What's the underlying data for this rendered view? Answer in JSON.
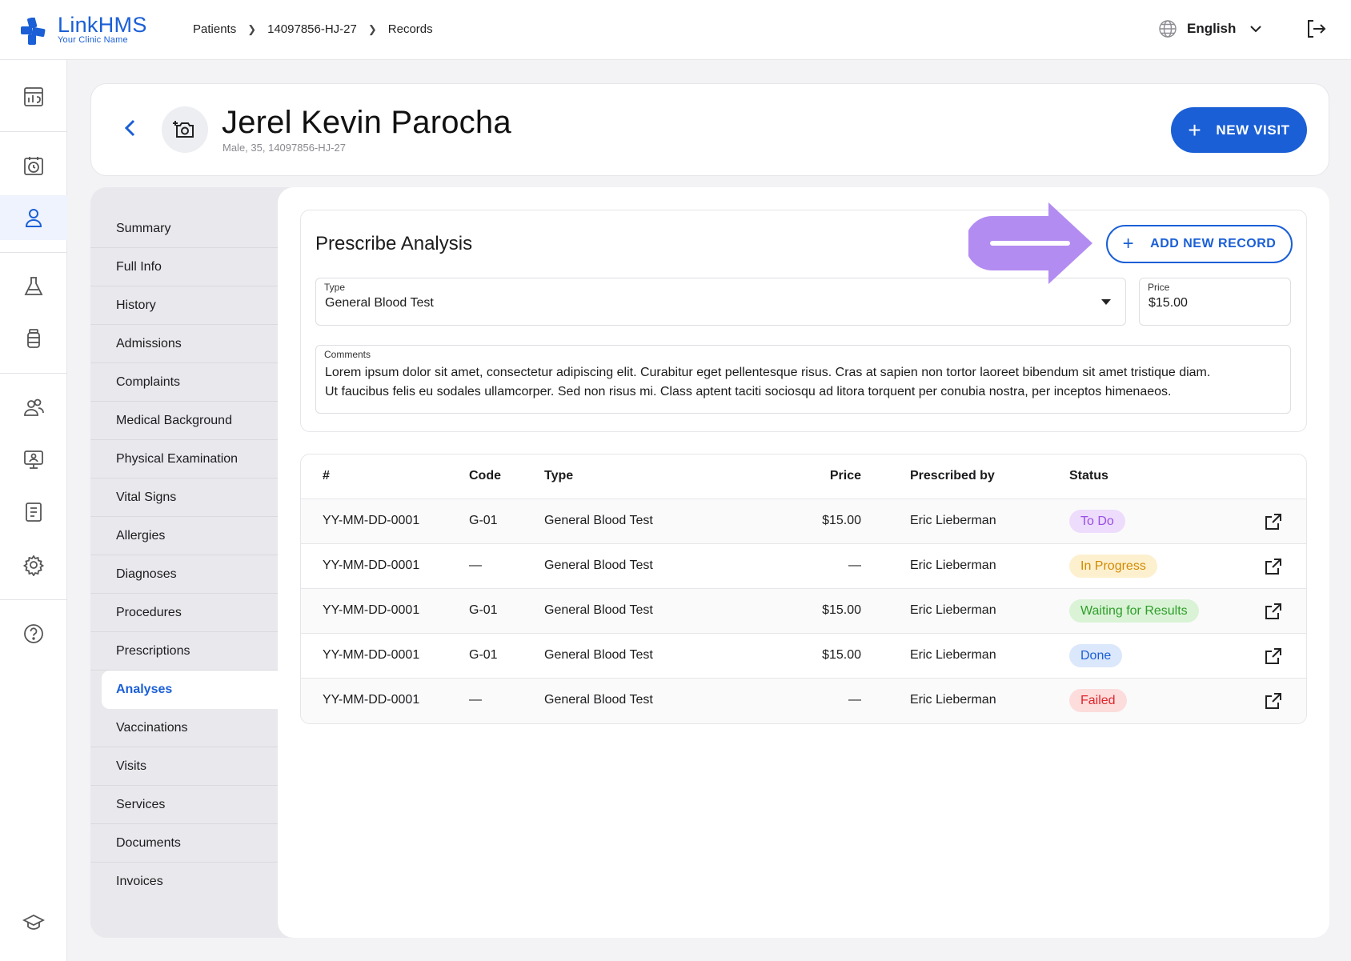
{
  "app": {
    "name": "LinkHMS",
    "clinic": "Your Clinic Name"
  },
  "breadcrumb": [
    "Patients",
    "14097856-HJ-27",
    "Records"
  ],
  "language": "English",
  "patient": {
    "name": "Jerel Kevin Parocha",
    "meta": "Male, 35, 14097856-HJ-27"
  },
  "header": {
    "new_visit_label": "NEW VISIT"
  },
  "sidebar": {
    "items": [
      "Summary",
      "Full Info",
      "History",
      "Admissions",
      "Complaints",
      "Medical Background",
      "Physical Examination",
      "Vital Signs",
      "Allergies",
      "Diagnoses",
      "Procedures",
      "Prescriptions",
      "Analyses",
      "Vaccinations",
      "Visits",
      "Services",
      "Documents",
      "Invoices"
    ],
    "active": "Analyses"
  },
  "prescribe": {
    "title": "Prescribe Analysis",
    "add_label": "ADD NEW RECORD",
    "type_label": "Type",
    "type_value": "General Blood Test",
    "price_label": "Price",
    "price_value": "$15.00",
    "comments_label": "Comments",
    "comments_value": "Lorem ipsum dolor sit amet, consectetur adipiscing elit. Curabitur eget pellentesque risus. Cras at sapien non tortor laoreet bibendum sit amet tristique diam. Ut faucibus felis eu sodales ullamcorper. Sed non risus mi. Class aptent taciti sociosqu ad litora torquent per conubia nostra, per inceptos himenaeos."
  },
  "table": {
    "headers": {
      "num": "#",
      "code": "Code",
      "type": "Type",
      "price": "Price",
      "by": "Prescribed by",
      "status": "Status"
    },
    "rows": [
      {
        "num": "YY-MM-DD-0001",
        "code": "G-01",
        "type": "General Blood Test",
        "price": "$15.00",
        "by": "Eric Lieberman",
        "status": "To Do"
      },
      {
        "num": "YY-MM-DD-0001",
        "code": "—",
        "type": "General Blood Test",
        "price": "—",
        "by": "Eric Lieberman",
        "status": "In Progress"
      },
      {
        "num": "YY-MM-DD-0001",
        "code": "G-01",
        "type": "General Blood Test",
        "price": "$15.00",
        "by": "Eric Lieberman",
        "status": "Waiting for Results"
      },
      {
        "num": "YY-MM-DD-0001",
        "code": "G-01",
        "type": "General Blood Test",
        "price": "$15.00",
        "by": "Eric Lieberman",
        "status": "Done"
      },
      {
        "num": "YY-MM-DD-0001",
        "code": "—",
        "type": "General Blood Test",
        "price": "—",
        "by": "Eric Lieberman",
        "status": "Failed"
      }
    ]
  },
  "status_colors": {
    "To Do": {
      "bg": "#eddcfb",
      "fg": "#9a4fe3"
    },
    "In Progress": {
      "bg": "#fdf0cf",
      "fg": "#d18b00"
    },
    "Waiting for Results": {
      "bg": "#daf3d6",
      "fg": "#2e9e2a"
    },
    "Done": {
      "bg": "#dbe7fb",
      "fg": "#1a5fd6"
    },
    "Failed": {
      "bg": "#fddcdc",
      "fg": "#e0252a"
    }
  },
  "colors": {
    "accent": "#1a5fd6",
    "highlight_arrow": "#b38cf2"
  }
}
